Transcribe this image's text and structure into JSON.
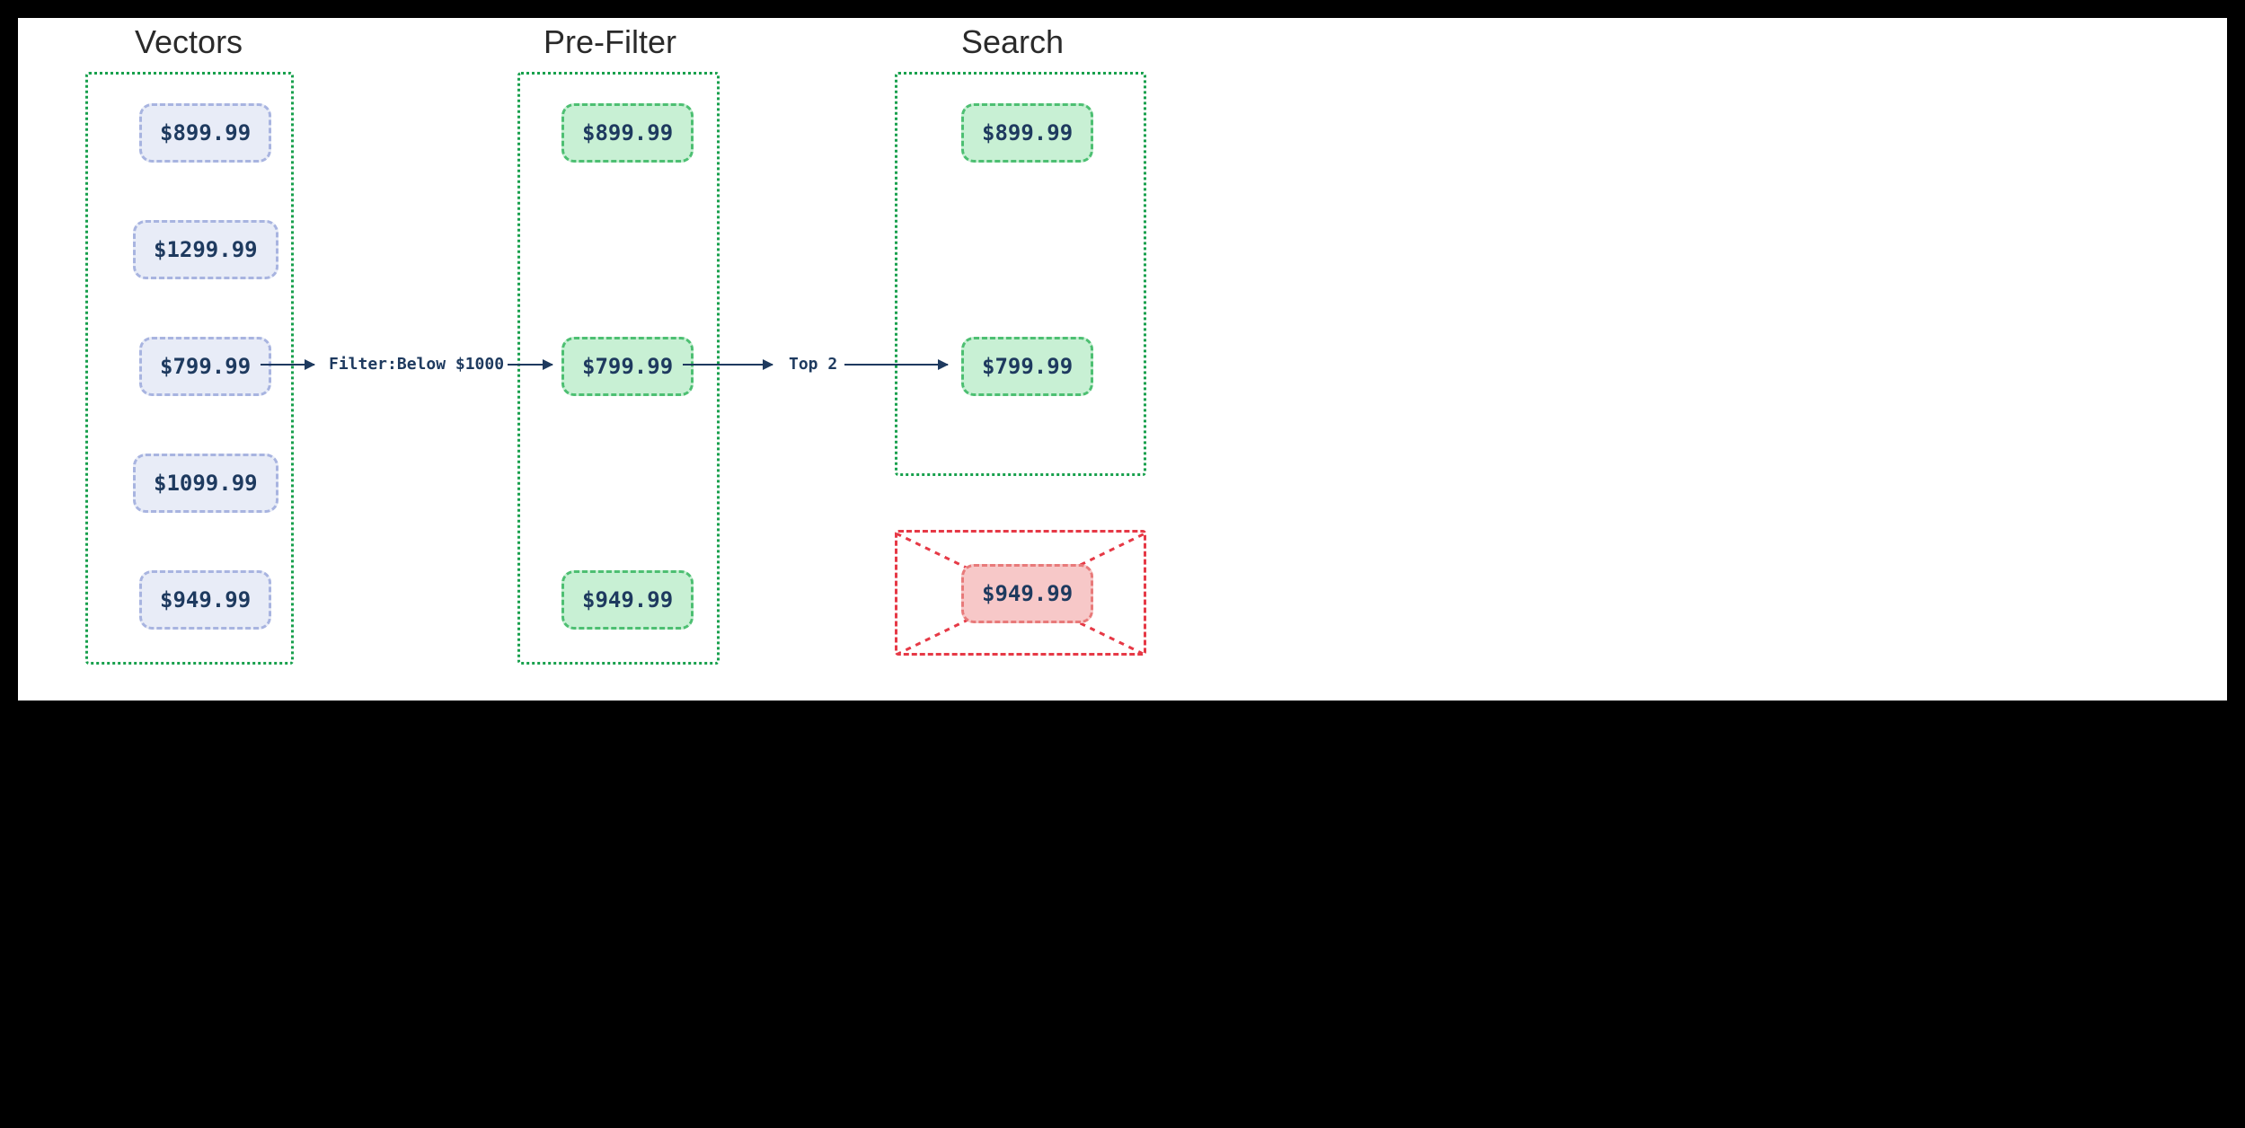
{
  "columns": {
    "vectors": {
      "title": "Vectors"
    },
    "prefilter": {
      "title": "Pre-Filter"
    },
    "search": {
      "title": "Search"
    }
  },
  "vectors": {
    "items": [
      "$899.99",
      "$1299.99",
      "$799.99",
      "$1099.99",
      "$949.99"
    ]
  },
  "prefilter": {
    "items": [
      "$899.99",
      "$799.99",
      "$949.99"
    ]
  },
  "search": {
    "accepted": [
      "$899.99",
      "$799.99"
    ],
    "rejected": "$949.99"
  },
  "arrows": {
    "filter_label": "Filter:Below $1000",
    "top_label": "Top 2"
  }
}
